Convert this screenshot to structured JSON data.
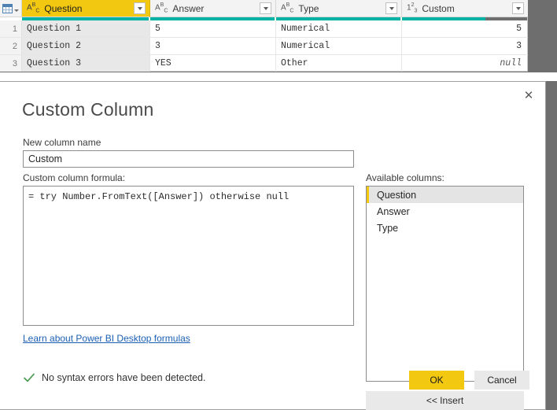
{
  "grid": {
    "corner_icon": "table-grid-icon",
    "columns": [
      {
        "name": "Question",
        "type_icon": "abc-text-type-icon",
        "selected": true,
        "filter_icon": "filter-dropdown-icon",
        "quality_valid_pct": 100
      },
      {
        "name": "Answer",
        "type_icon": "abc-text-type-icon",
        "selected": false,
        "filter_icon": "filter-dropdown-icon",
        "quality_valid_pct": 100
      },
      {
        "name": "Type",
        "type_icon": "abc-text-type-icon",
        "selected": false,
        "filter_icon": "filter-dropdown-icon",
        "quality_valid_pct": 100
      },
      {
        "name": "Custom",
        "type_icon": "123-number-type-icon",
        "selected": false,
        "filter_icon": "filter-dropdown-icon",
        "quality_valid_pct": 67
      }
    ],
    "rows": [
      {
        "num": "1",
        "question": "Question 1",
        "answer": "5",
        "type": "Numerical",
        "custom": "5",
        "custom_is_null": false
      },
      {
        "num": "2",
        "question": "Question 2",
        "answer": "3",
        "type": "Numerical",
        "custom": "3",
        "custom_is_null": false
      },
      {
        "num": "3",
        "question": "Question 3",
        "answer": "YES",
        "type": "Other",
        "custom": "null",
        "custom_is_null": true
      }
    ]
  },
  "dialog": {
    "title": "Custom Column",
    "close_icon": "close-x-icon",
    "new_column_name_label": "New column name",
    "new_column_name_value": "Custom",
    "new_column_name_placeholder": "",
    "formula_label": "Custom column formula:",
    "formula_value": "= try Number.FromText([Answer]) otherwise null",
    "learn_link": "Learn about Power BI Desktop formulas",
    "available_columns_label": "Available columns:",
    "available_columns": [
      {
        "label": "Question",
        "selected": true
      },
      {
        "label": "Answer",
        "selected": false
      },
      {
        "label": "Type",
        "selected": false
      }
    ],
    "insert_label": "<< Insert",
    "status_icon": "green-check-icon",
    "status_text": "No syntax errors have been detected.",
    "ok_label": "OK",
    "cancel_label": "Cancel"
  },
  "colors": {
    "accent_yellow": "#F2C811",
    "quality_teal": "#00B3A4",
    "quality_gray": "#6E6E6E",
    "link_blue": "#1A5FB4",
    "check_green": "#4C9A52",
    "chrome_gray": "#6E6E6E"
  }
}
